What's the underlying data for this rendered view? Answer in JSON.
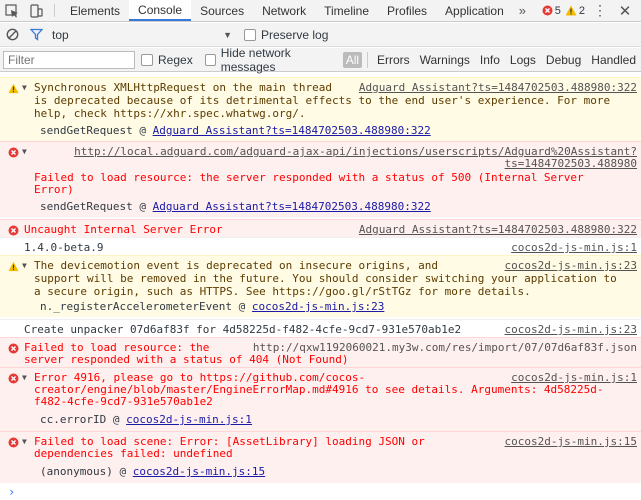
{
  "tabs": [
    {
      "label": "Elements"
    },
    {
      "label": "Console"
    },
    {
      "label": "Sources"
    },
    {
      "label": "Network"
    },
    {
      "label": "Timeline"
    },
    {
      "label": "Profiles"
    },
    {
      "label": "Application"
    }
  ],
  "more_tabs": "»",
  "counts": {
    "errors": "5",
    "warnings": "2"
  },
  "context": {
    "label": "top"
  },
  "preserve_log": "Preserve log",
  "filter": {
    "placeholder": "Filter"
  },
  "regex_label": "Regex",
  "hide_network_label": "Hide network messages",
  "levels": [
    "All",
    "Errors",
    "Warnings",
    "Info",
    "Logs",
    "Debug",
    "Handled"
  ],
  "colors": {
    "accent": "#3879d9",
    "error": "#ff0000",
    "warning_bg": "#fffbe5",
    "error_bg": "#fff0f0"
  },
  "messages": [
    {
      "level": "warning",
      "source": "Adguard Assistant?ts=1484702503.488980:322",
      "text1": "Synchronous XMLHttpRequest on the main thread",
      "text2": "is deprecated because of its detrimental effects to the end user's experience. For more",
      "text3": "help, check https://xhr.spec.whatwg.org/.",
      "stack_fn": "sendGetRequest @ ",
      "stack_link": "Adguard Assistant?ts=1484702503.488980:322"
    },
    {
      "level": "error",
      "url": "http://local.adguard.com/adguard-ajax-api/injections/userscripts/Adguard%20Assistant?",
      "url2": "ts=1484702503.488980",
      "text1": "Failed to load resource: the server responded with a status of 500 (Internal Server",
      "text2": "Error)",
      "stack_fn": "sendGetRequest @ ",
      "stack_link": "Adguard Assistant?ts=1484702503.488980:322"
    },
    {
      "level": "error",
      "text1": "Uncaught Internal Server Error",
      "source": "Adguard Assistant?ts=1484702503.488980:322"
    },
    {
      "level": "log",
      "text1": "1.4.0-beta.9",
      "source": "cocos2d-js-min.js:1"
    },
    {
      "level": "warning",
      "source": "cocos2d-js-min.js:23",
      "text1": "The devicemotion event is deprecated on insecure origins, and",
      "text2": "support will be removed in the future. You should consider switching your application to",
      "text3": "a secure origin, such as HTTPS. See https://goo.gl/rStTGz for more details.",
      "stack_fn": "n._registerAccelerometerEvent @ ",
      "stack_link": "cocos2d-js-min.js:23"
    },
    {
      "level": "log",
      "text1": "Create unpacker 07d6af83f for 4d58225d-f482-4cfe-9cd7-931e570ab1e2",
      "source": "cocos2d-js-min.js:23"
    },
    {
      "level": "error",
      "text1": "Failed to load resource: the",
      "url": "http://qxw1192060021.my3w.com/res/import/07/07d6af83f.json",
      "text2": "server responded with a status of 404 (Not Found)"
    },
    {
      "level": "error",
      "text1": "Error 4916, please go to https://github.com/cocos-",
      "source": "cocos2d-js-min.js:1",
      "text2": "creator/engine/blob/master/EngineErrorMap.md#4916 to see details. Arguments: 4d58225d-",
      "text3": "f482-4cfe-9cd7-931e570ab1e2",
      "stack_fn": "cc.errorID @ ",
      "stack_link": "cocos2d-js-min.js:1"
    },
    {
      "level": "error",
      "text1": "Failed to load scene: Error: [AssetLibrary] loading JSON or",
      "source": "cocos2d-js-min.js:15",
      "text2": "dependencies failed: undefined",
      "stack_fn": "(anonymous) @ ",
      "stack_link": "cocos2d-js-min.js:15"
    }
  ],
  "prompt": "›"
}
